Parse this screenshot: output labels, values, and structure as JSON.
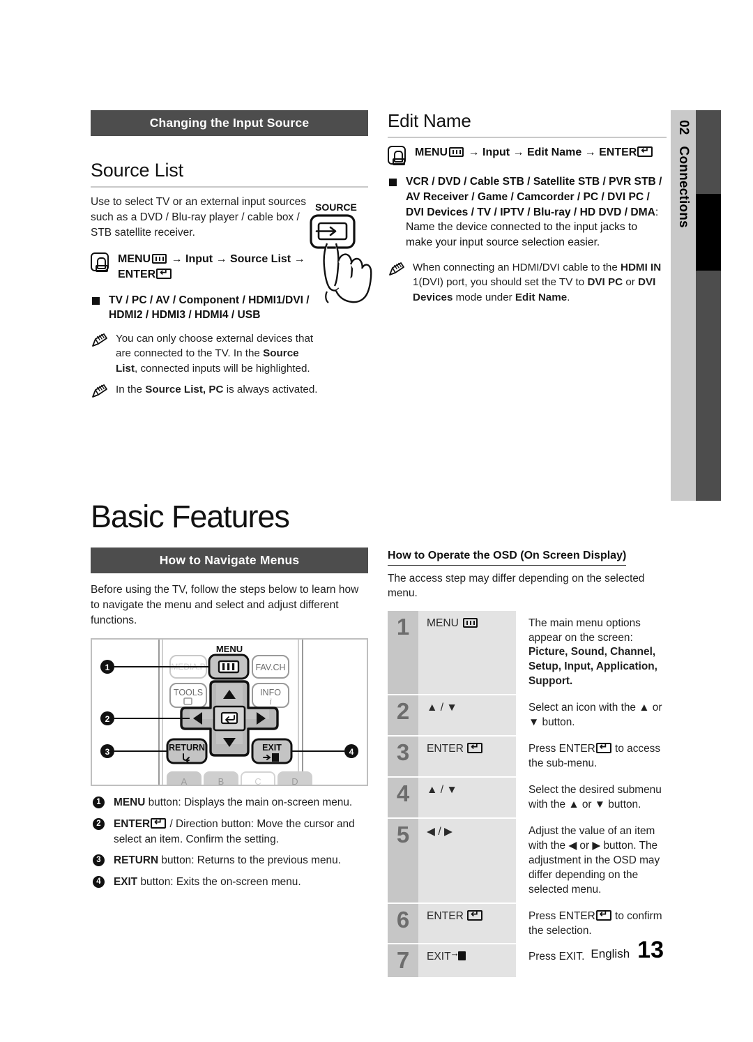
{
  "sidetab": {
    "number": "02",
    "label": "Connections"
  },
  "footer": {
    "lang": "English",
    "page": "13"
  },
  "left": {
    "section_bar": "Changing the Input Source",
    "source_list": {
      "heading": "Source List",
      "intro": "Use to select TV or an external input sources such as a DVD / Blu-ray player / cable box / STB satellite receiver.",
      "path_prefix": "MENU",
      "path_middle": " → Input → Source List → ",
      "path_enter": "ENTER",
      "bullet": "TV / PC / AV / Component / HDMI1/DVI / HDMI2 / HDMI3 / HDMI4 / USB",
      "notes": [
        {
          "a": "You can only choose external devices that are connected to the TV. In the ",
          "b": "Source List",
          "c": ", connected inputs will be highlighted."
        },
        {
          "a": "In the ",
          "b": "Source List, PC",
          "c": " is always activated."
        }
      ],
      "source_button_label": "SOURCE"
    }
  },
  "right_top": {
    "heading": "Edit Name",
    "path_prefix": "MENU",
    "path_middle": " → Input → Edit Name → ",
    "path_enter": "ENTER",
    "bullet_bold": "VCR / DVD / Cable STB / Satellite STB / PVR STB / AV Receiver / Game / Camcorder / PC / DVI PC / DVI Devices  / TV / IPTV / Blu-ray / HD DVD / DMA",
    "bullet_rest": ": Name the device connected to the input jacks to make your input source selection easier.",
    "note": {
      "p1": "When connecting an HDMI/DVI cable to the ",
      "b1": "HDMI IN",
      "p2": " 1(DVI) port, you should set the TV to ",
      "b2": "DVI PC",
      "p3": " or ",
      "b3": "DVI Devices",
      "p4": " mode under ",
      "b4": "Edit Name",
      "p5": "."
    }
  },
  "basic": {
    "title": "Basic Features",
    "section_bar": "How to Navigate Menus",
    "intro": "Before using the TV, follow the steps below to learn how to navigate the menu and select and adjust different functions.",
    "remote": {
      "menu_label": "MENU",
      "media_label": "MEDIA.P",
      "fav_label": "FAV.CH",
      "tools_label": "TOOLS",
      "info_label": "INFO",
      "return_label": "RETURN",
      "exit_label": "EXIT",
      "color_buttons": [
        "A",
        "B",
        "C",
        "D"
      ],
      "callouts": [
        "1",
        "2",
        "3",
        "4"
      ]
    },
    "legend": [
      {
        "n": "1",
        "b": "MENU",
        "t": " button: Displays the main on-screen menu."
      },
      {
        "n": "2",
        "b": "ENTER",
        "t": " / Direction button: Move the cursor and select an item. Confirm the setting.",
        "icon": "enter"
      },
      {
        "n": "3",
        "b": "RETURN",
        "t": " button: Returns to the previous menu."
      },
      {
        "n": "4",
        "b": "EXIT",
        "t": " button: Exits the on-screen menu."
      }
    ]
  },
  "osd": {
    "heading": "How to Operate the OSD (On Screen Display)",
    "subtitle": "The access step may differ depending on the selected menu.",
    "rows": [
      {
        "num": "1",
        "key": "MENU",
        "key_icon": "menu",
        "desc_a": "The main menu options appear on the screen:",
        "desc_b": "Picture, Sound, Channel, Setup, Input, Application, Support."
      },
      {
        "num": "2",
        "key": "▲ / ▼",
        "key_icon": "",
        "desc_a": "Select an icon with the ▲ or ▼ button.",
        "desc_b": ""
      },
      {
        "num": "3",
        "key": "ENTER",
        "key_icon": "enter",
        "desc_a": "Press ENTER",
        "desc_b": " to access the sub-menu.",
        "desc_icon": "enter"
      },
      {
        "num": "4",
        "key": "▲ / ▼",
        "key_icon": "",
        "desc_a": "Select the desired submenu with the ▲ or ▼ button.",
        "desc_b": ""
      },
      {
        "num": "5",
        "key": "◀ / ▶",
        "key_icon": "",
        "desc_a": "Adjust the value of an item with the ◀ or ▶ button. The adjustment in the OSD may differ depending on the selected menu.",
        "desc_b": ""
      },
      {
        "num": "6",
        "key": "ENTER",
        "key_icon": "enter",
        "desc_a": "Press ENTER",
        "desc_b": " to confirm the selection.",
        "desc_icon": "enter"
      },
      {
        "num": "7",
        "key": "EXIT",
        "key_icon": "exit",
        "desc_a": "Press EXIT.",
        "desc_b": ""
      }
    ]
  }
}
